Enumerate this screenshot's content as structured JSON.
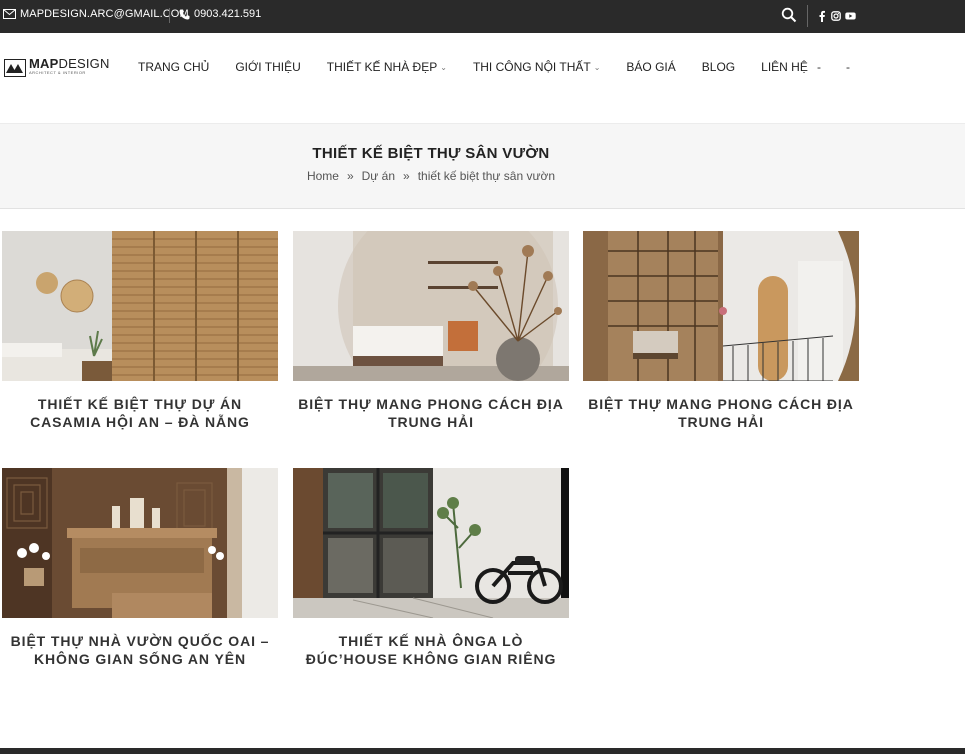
{
  "topbar": {
    "email": "MAPDESIGN.ARC@GMAIL.COM",
    "phone": "0903.421.591",
    "icons": [
      "mail-icon",
      "phone-icon",
      "search-icon",
      "facebook-icon",
      "instagram-icon",
      "youtube-icon"
    ]
  },
  "logo": {
    "brand_bold": "MAP",
    "brand_light": "DESIGN",
    "tagline": "ARCHITECT & INTERIOR"
  },
  "nav": {
    "items": [
      {
        "label": "TRANG CHỦ"
      },
      {
        "label": "GIỚI THIỆU"
      },
      {
        "label": "THIẾT KẾ NHÀ ĐẸP"
      },
      {
        "label": "THI CÔNG NỘI THẤT"
      },
      {
        "label": "BÁO GIÁ"
      },
      {
        "label": "BLOG"
      },
      {
        "label": "LIÊN HỆ"
      }
    ],
    "extra_1": "-",
    "extra_2": "-"
  },
  "page": {
    "title": "THIẾT KẾ BIỆT THỰ SÂN VƯỜN",
    "breadcrumb": [
      "Home",
      "Dự án",
      "thiết kế biệt thự sân vườn"
    ],
    "breadcrumb_sep": "»"
  },
  "projects": [
    {
      "title": "THIẾT KẾ BIỆT THỰ DỰ ÁN CASAMIA HỘI AN – ĐÀ NẴNG"
    },
    {
      "title": "BIỆT THỰ MANG PHONG CÁCH ĐỊA TRUNG HẢI"
    },
    {
      "title": "BIỆT THỰ MANG PHONG CÁCH ĐỊA TRUNG HẢI"
    },
    {
      "title": "BIỆT THỰ NHÀ VƯỜN QUỐC OAI – KHÔNG GIAN SỐNG AN YÊN"
    },
    {
      "title": "THIẾT KẾ NHÀ ÔNGA LÒ ĐÚC’HOUSE KHÔNG GIAN RIÊNG"
    }
  ],
  "colors": {
    "topbar_bg": "#2a2a2a",
    "title_band_bg": "#f6f6f6",
    "text_dark": "#222222",
    "wood": "#b48a5a"
  }
}
